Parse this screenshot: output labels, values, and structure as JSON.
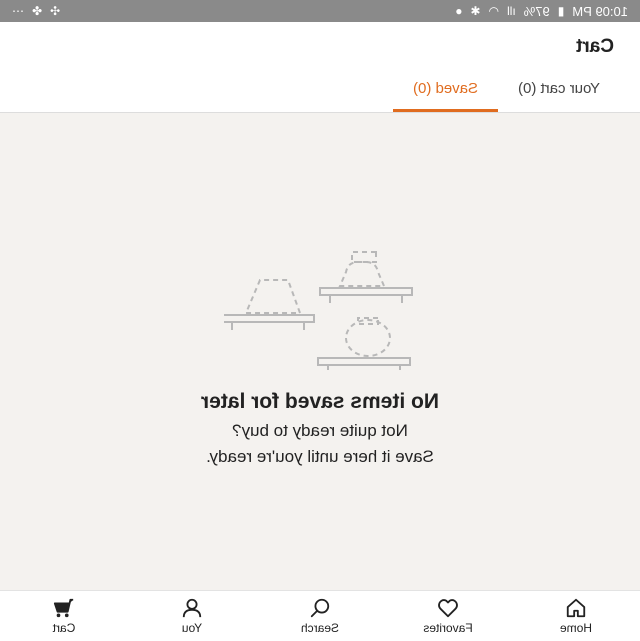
{
  "statusbar": {
    "time": "10:09 PM",
    "battery": "97%",
    "left_icons": [
      "battery-icon",
      "signal-icon",
      "wifi-icon",
      "bluetooth-icon",
      "location-icon"
    ],
    "right_icons": [
      "fan-icon",
      "blades-icon",
      "more-icon"
    ]
  },
  "header": {
    "title": "Cart",
    "tabs": [
      {
        "label": "Your cart (0)",
        "active": false
      },
      {
        "label": "Saved (0)",
        "active": true
      }
    ]
  },
  "empty_state": {
    "title": "No items saved for later",
    "line1": "Not quite ready to buy?",
    "line2": "Save it here until you're ready."
  },
  "bottom_nav": [
    {
      "label": "Home",
      "icon": "home-icon"
    },
    {
      "label": "Favorites",
      "icon": "heart-icon"
    },
    {
      "label": "Search",
      "icon": "search-icon"
    },
    {
      "label": "You",
      "icon": "person-icon"
    },
    {
      "label": "Cart",
      "icon": "cart-icon"
    }
  ],
  "colors": {
    "accent": "#e06c1f",
    "background": "#f4f2ef",
    "statusbar": "#8a8a8a"
  }
}
